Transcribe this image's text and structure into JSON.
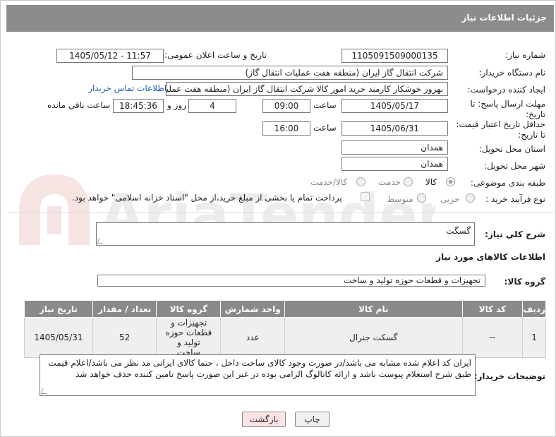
{
  "header": {
    "title": "جزئیات اطلاعات نیاز"
  },
  "form": {
    "need_number": {
      "label": "شماره نیاز:",
      "value": "1105091509000135"
    },
    "announce_datetime": {
      "label": "تاریخ و ساعت اعلان عمومی:",
      "value": "1405/05/12 - 11:57"
    },
    "buyer_org": {
      "label": "نام دستگاه خریدار:",
      "value": "شرکت انتقال گاز ایران (منطقه هفت عملیات انتقال گاز)"
    },
    "requester": {
      "label": "ایجاد کننده درخواست:",
      "value": "بهروز خوشکار کارمند خرید امور کالا شرکت انتقال گاز ایران (منطقه هفت عملیات",
      "contact_link": "اطلاعات تماس خریدار"
    },
    "reply_deadline": {
      "label": "مهلت ارسال پاسخ: تا تاریخ:",
      "date": "1405/05/17",
      "time_label": "ساعت",
      "time": "09:00",
      "days": "4",
      "days_label": "روز و",
      "remaining": "18:45:36",
      "remaining_label": "ساعت باقی مانده"
    },
    "price_validity": {
      "label": "حداقل تاریخ اعتبار قیمت: تا تاریخ:",
      "date": "1405/06/31",
      "time_label": "ساعت",
      "time": "16:00"
    },
    "delivery_province": {
      "label": "استان محل تحویل:",
      "value": "همدان"
    },
    "delivery_city": {
      "label": "شهر محل تحویل:",
      "value": "همدان"
    },
    "category": {
      "label": "طبقه بندی موضوعی:",
      "options": [
        "کالا",
        "خدمت",
        "کالا/خدمت"
      ],
      "selected": "کالا"
    },
    "purchase_type": {
      "label": "نوع فرآیند خرید :",
      "options": [
        "جزیی",
        "متوسط"
      ],
      "payment_note": "پرداخت تمام یا بخشی از مبلغ خرید،از محل \"اسناد خزانه اسلامی\" خواهد بود."
    }
  },
  "summary": {
    "label": "شرح کلي نياز:",
    "value": "گسگت"
  },
  "goods_info": {
    "title": "اطلاعات کالاهای مورد نیاز",
    "group_label": "گروه کالا:",
    "group_value": "تجهیزات و قطعات حوزه تولید و ساخت"
  },
  "table": {
    "headers": [
      "ردیف",
      "کد کالا",
      "نام کالا",
      "واحد شمارش",
      "گروه کالا",
      "تعداد / مقدار",
      "تاریخ نیاز"
    ],
    "rows": [
      {
        "index": "1",
        "code": "--",
        "name": "گسکت جنرال",
        "unit": "عدد",
        "group": "تجهیزات و قطعات حوزه تولید و ساخت",
        "qty": "52",
        "date": "1405/05/31"
      }
    ]
  },
  "buyer_notes": {
    "label": "توضیحات خریدار:",
    "value": "ایران کد اعلام شده مشابه می باشد/در صورت وجود کالای ساخت داخل ، حتما کالای ایرانی مد نظر می باشد/اعلام قیمت طبق شرح استعلام پیوست باشد و ارائه کاتالوگ الزامی بوده در غیر این صورت پاسخ تامین کننده حذف خواهد شد"
  },
  "buttons": {
    "print": "چاپ",
    "back": "بازگشت"
  },
  "watermark": {
    "text": "AriaTender.neT"
  }
}
